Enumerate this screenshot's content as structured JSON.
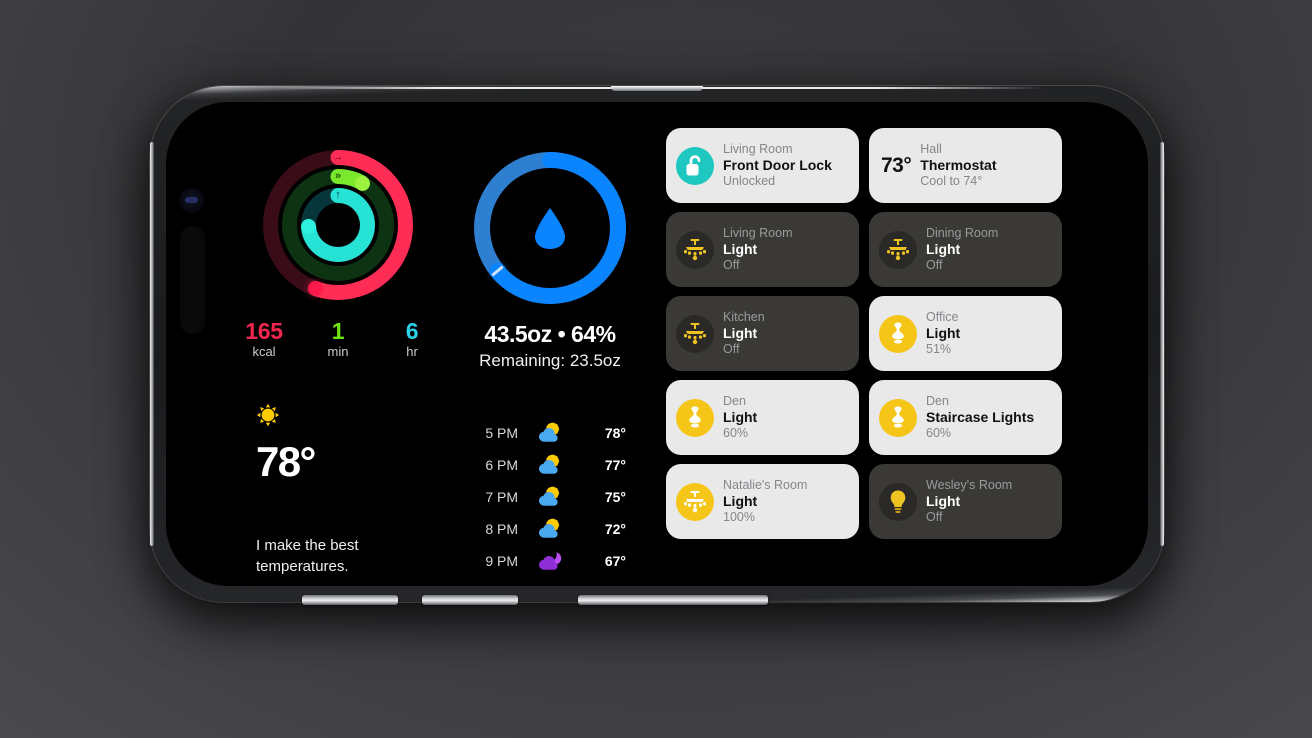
{
  "device": {
    "name": "iPhone",
    "orientation": "landscape",
    "buttons": [
      "volume-up",
      "volume-down",
      "power"
    ]
  },
  "fitness": {
    "widget_name": "Activity Rings",
    "rings": [
      {
        "name": "Move",
        "color": "#ff2d55",
        "progress_turn": 0.555,
        "glyph": "→"
      },
      {
        "name": "Exercise",
        "color": "#7ae82c",
        "progress_turn": 0.085,
        "glyph": "»"
      },
      {
        "name": "Stand",
        "color": "#27e3d6",
        "progress_turn": 0.74,
        "glyph": "↑"
      }
    ],
    "metrics": [
      {
        "value": "165",
        "unit": "kcal",
        "color": "#f2264f"
      },
      {
        "value": "1",
        "unit": "min",
        "color": "#6fe312"
      },
      {
        "value": "6",
        "unit": "hr",
        "color": "#2ad2e8"
      }
    ]
  },
  "weather": {
    "icon": "sun-icon",
    "icon_glyph": "☀",
    "temperature": "78°",
    "caption": "I make the best temperatures.",
    "hourly": [
      {
        "time": "5 PM",
        "icon": "sun-behind-cloud-icon",
        "icon_glyph": "⛅",
        "temp": "78°"
      },
      {
        "time": "6 PM",
        "icon": "sun-behind-cloud-icon",
        "icon_glyph": "⛅",
        "temp": "77°"
      },
      {
        "time": "7 PM",
        "icon": "sun-behind-cloud-icon",
        "icon_glyph": "⛅",
        "temp": "75°"
      },
      {
        "time": "8 PM",
        "icon": "sun-behind-cloud-icon",
        "icon_glyph": "⛅",
        "temp": "72°"
      },
      {
        "time": "9 PM",
        "icon": "moon-behind-cloud-icon",
        "icon_glyph": "☾",
        "temp": "67°"
      }
    ]
  },
  "water": {
    "widget_name": "Hydration",
    "icon": "water-drop-icon",
    "progress_turn": 0.64,
    "ring_color": "#0a84ff",
    "track_color": "#2f7fd1",
    "total": "43.5oz • 64%",
    "remaining": "Remaining: 23.5oz"
  },
  "home": {
    "tiles": [
      {
        "room": "Living Room",
        "name": "Front Door Lock",
        "status": "Unlocked",
        "state": "on",
        "icon": "unlocked-padlock-icon",
        "icon_style": "teal"
      },
      {
        "room": "Hall",
        "name": "Thermostat",
        "status": "Cool to 74°",
        "state": "on",
        "icon": "thermostat-temperature",
        "icon_style": "plain",
        "temp": "73°"
      },
      {
        "room": "Living Room",
        "name": "Light",
        "status": "Off",
        "state": "off",
        "icon": "chandelier-icon",
        "icon_style": "dark"
      },
      {
        "room": "Dining Room",
        "name": "Light",
        "status": "Off",
        "state": "off",
        "icon": "chandelier-icon",
        "icon_style": "dark"
      },
      {
        "room": "Kitchen",
        "name": "Light",
        "status": "Off",
        "state": "off",
        "icon": "chandelier-icon",
        "icon_style": "dark"
      },
      {
        "room": "Office",
        "name": "Light",
        "status": "51%",
        "state": "on",
        "icon": "pendant-lamp-icon",
        "icon_style": "yellow"
      },
      {
        "room": "Den",
        "name": "Light",
        "status": "60%",
        "state": "on",
        "icon": "pendant-lamp-icon",
        "icon_style": "yellow"
      },
      {
        "room": "Den",
        "name": "Staircase Lights",
        "status": "60%",
        "state": "on",
        "icon": "pendant-lamp-icon",
        "icon_style": "yellow"
      },
      {
        "room": "Natalie's Room",
        "name": "Light",
        "status": "100%",
        "state": "on",
        "icon": "chandelier-icon",
        "icon_style": "yellow"
      },
      {
        "room": "Wesley's Room",
        "name": "Light",
        "status": "Off",
        "state": "off",
        "icon": "bulb-icon",
        "icon_style": "dark"
      }
    ]
  }
}
